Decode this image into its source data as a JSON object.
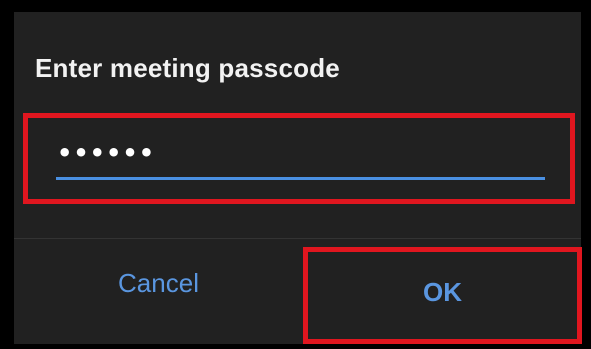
{
  "dialog": {
    "title": "Enter meeting passcode",
    "passcode_field": {
      "value": "••••••",
      "masked": true
    },
    "cancel_label": "Cancel",
    "ok_label": "OK"
  },
  "colors": {
    "dialog_background": "#212121",
    "text": "#f2f2f2",
    "accent": "#5a96e0",
    "input_underline": "#4a90e2",
    "highlight_box": "#e0161f"
  }
}
